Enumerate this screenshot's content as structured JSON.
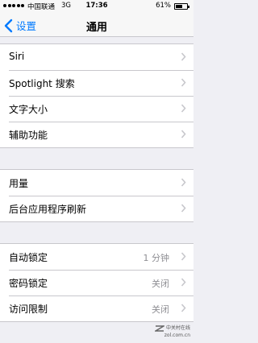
{
  "status_bar": {
    "carrier": "中国联通",
    "network": "3G",
    "time": "17:36",
    "battery_percent_label": "61%",
    "battery_level": 0.61
  },
  "nav": {
    "back_label": "设置",
    "title": "通用"
  },
  "groups": [
    {
      "rows": [
        {
          "label": "Siri"
        },
        {
          "label": "Spotlight 搜索"
        },
        {
          "label": "文字大小"
        },
        {
          "label": "辅助功能"
        }
      ]
    },
    {
      "rows": [
        {
          "label": "用量"
        },
        {
          "label": "后台应用程序刷新"
        }
      ]
    },
    {
      "rows": [
        {
          "label": "自动锁定",
          "value": "1 分钟"
        },
        {
          "label": "密码锁定",
          "value": "关闭"
        },
        {
          "label": "访问限制",
          "value": "关闭"
        }
      ]
    }
  ],
  "watermark": {
    "line1": "中关村在线",
    "line2": "zol.com.cn"
  },
  "colors": {
    "accent": "#007aff",
    "background": "#efeff4",
    "separator": "#c8c7cc",
    "secondary_text": "#8e8e93",
    "chevron": "#c7c7cc"
  }
}
